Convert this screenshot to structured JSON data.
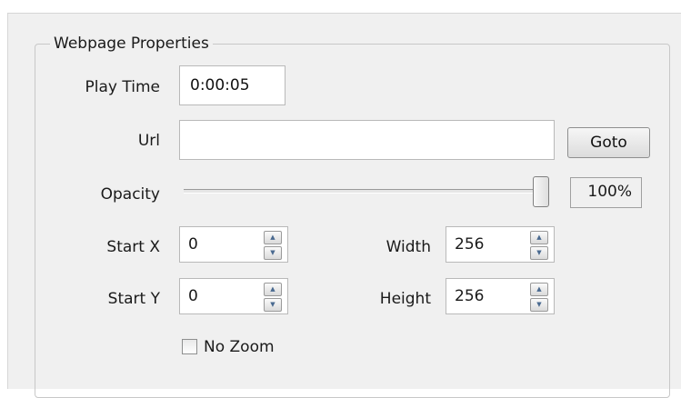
{
  "group": {
    "title": "Webpage Properties"
  },
  "play_time": {
    "label": "Play Time",
    "value": "0:00:05"
  },
  "url": {
    "label": "Url",
    "value": "",
    "button_label": "Goto"
  },
  "opacity": {
    "label": "Opacity",
    "value_text": "100%",
    "level": 1.0
  },
  "start_x": {
    "label": "Start X",
    "value": "0"
  },
  "start_y": {
    "label": "Start Y",
    "value": "0"
  },
  "width": {
    "label": "Width",
    "value": "256"
  },
  "height": {
    "label": "Height",
    "value": "256"
  },
  "no_zoom": {
    "label": "No Zoom",
    "checked": false
  },
  "icons": {
    "spin_up": "spin-up-arrow-icon",
    "spin_down": "spin-down-arrow-icon"
  }
}
